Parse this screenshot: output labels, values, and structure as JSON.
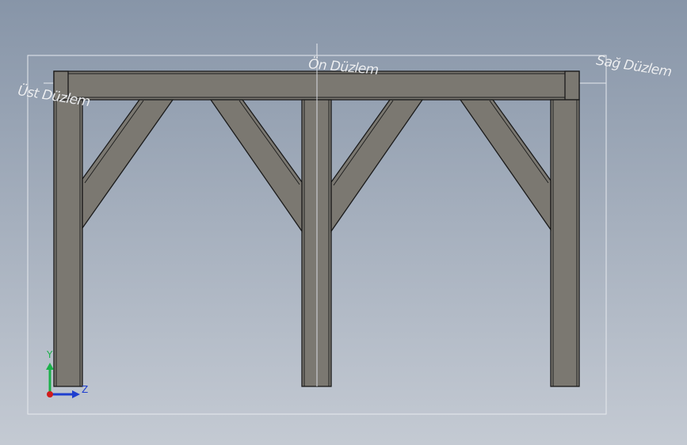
{
  "viewport": {
    "background_top": "#8795a8",
    "background_bottom": "#c4cad3"
  },
  "planes": {
    "front_label": "Ön Düzlem",
    "right_label": "Sağ Düzlem",
    "top_label": "Üst Düzlem"
  },
  "triad": {
    "y_label": "Y",
    "z_label": "Z",
    "y_color": "#1bb14a",
    "z_color": "#1f3fcf",
    "origin_color": "#d01c1c"
  },
  "model": {
    "member_fill": "#7b7871",
    "member_edge": "#1a1a1a"
  }
}
